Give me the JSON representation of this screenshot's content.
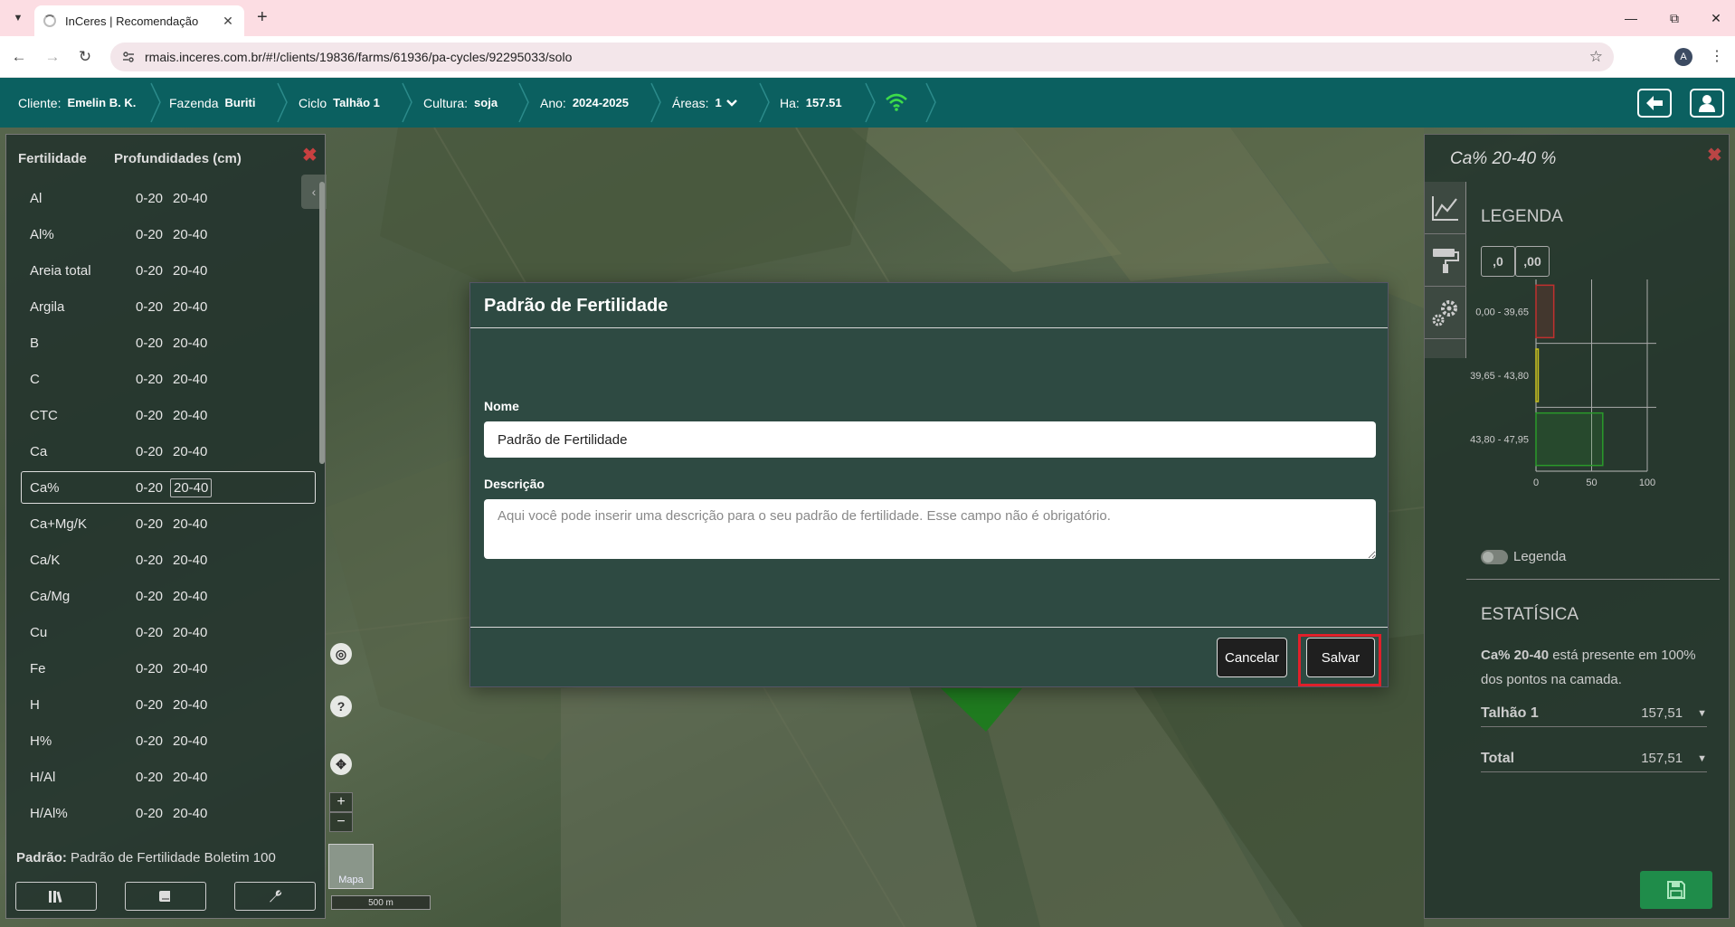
{
  "browser": {
    "tab_title": "InCeres | Recomendação",
    "url": "rmais.inceres.com.br/#!/clients/19836/farms/61936/pa-cycles/92295033/solo",
    "profile_initial": "A"
  },
  "header": {
    "cliente_label": "Cliente:",
    "cliente_value": "Emelin B. K.",
    "fazenda_label": "Fazenda",
    "fazenda_value": "Buriti",
    "ciclo_label": "Ciclo",
    "ciclo_value": "Talhão 1",
    "cultura_label": "Cultura:",
    "cultura_value": "soja",
    "ano_label": "Ano:",
    "ano_value": "2024-2025",
    "areas_label": "Áreas:",
    "areas_value": "1",
    "ha_label": "Ha:",
    "ha_value": "157.51"
  },
  "left_panel": {
    "col1": "Fertilidade",
    "col2": "Profundidades (cm)",
    "rows": [
      {
        "name": "Al",
        "d1": "0-20",
        "d2": "20-40"
      },
      {
        "name": "Al%",
        "d1": "0-20",
        "d2": "20-40"
      },
      {
        "name": "Areia total",
        "d1": "0-20",
        "d2": "20-40"
      },
      {
        "name": "Argila",
        "d1": "0-20",
        "d2": "20-40"
      },
      {
        "name": "B",
        "d1": "0-20",
        "d2": "20-40"
      },
      {
        "name": "C",
        "d1": "0-20",
        "d2": "20-40"
      },
      {
        "name": "CTC",
        "d1": "0-20",
        "d2": "20-40"
      },
      {
        "name": "Ca",
        "d1": "0-20",
        "d2": "20-40"
      },
      {
        "name": "Ca%",
        "d1": "0-20",
        "d2": "20-40"
      },
      {
        "name": "Ca+Mg/K",
        "d1": "0-20",
        "d2": "20-40"
      },
      {
        "name": "Ca/K",
        "d1": "0-20",
        "d2": "20-40"
      },
      {
        "name": "Ca/Mg",
        "d1": "0-20",
        "d2": "20-40"
      },
      {
        "name": "Cu",
        "d1": "0-20",
        "d2": "20-40"
      },
      {
        "name": "Fe",
        "d1": "0-20",
        "d2": "20-40"
      },
      {
        "name": "H",
        "d1": "0-20",
        "d2": "20-40"
      },
      {
        "name": "H%",
        "d1": "0-20",
        "d2": "20-40"
      },
      {
        "name": "H/Al",
        "d1": "0-20",
        "d2": "20-40"
      },
      {
        "name": "H/Al%",
        "d1": "0-20",
        "d2": "20-40"
      }
    ],
    "padrao_label": "Padrão:",
    "padrao_value": "Padrão de Fertilidade Boletim 100"
  },
  "map": {
    "thumb_label": "Mapa",
    "scale_label": "500 m"
  },
  "modal": {
    "title": "Padrão de Fertilidade",
    "nome_label": "Nome",
    "nome_value": "Padrão de Fertilidade",
    "descricao_label": "Descrição",
    "descricao_placeholder": "Aqui você pode inserir uma descrição para o seu padrão de fertilidade. Esse campo não é obrigatório.",
    "cancel_label": "Cancelar",
    "save_label": "Salvar"
  },
  "right_panel": {
    "title": "Ca% 20-40 %",
    "legend_title": "LEGENDA",
    "dec_left": ",0",
    "dec_right": ",00",
    "legend_toggle_label": "Legenda",
    "stat_title": "ESTATÍSICA",
    "stat_bold": "Ca% 20-40",
    "stat_text": " está presente em 100% dos pontos na camada.",
    "rows": [
      {
        "name": "Talhão 1",
        "value": "157,51"
      },
      {
        "name": "Total",
        "value": "157,51"
      }
    ]
  },
  "chart_data": {
    "type": "bar",
    "orientation": "horizontal",
    "categories": [
      "0,00 - 39,65",
      "39,65 - 43,80",
      "43,80 - 47,95"
    ],
    "values": [
      16,
      2,
      60
    ],
    "colors": [
      "#c0302f",
      "#c8c020",
      "#2a9a2a"
    ],
    "x_ticks": [
      "0",
      "50",
      "100"
    ],
    "xlim": [
      0,
      100
    ]
  }
}
